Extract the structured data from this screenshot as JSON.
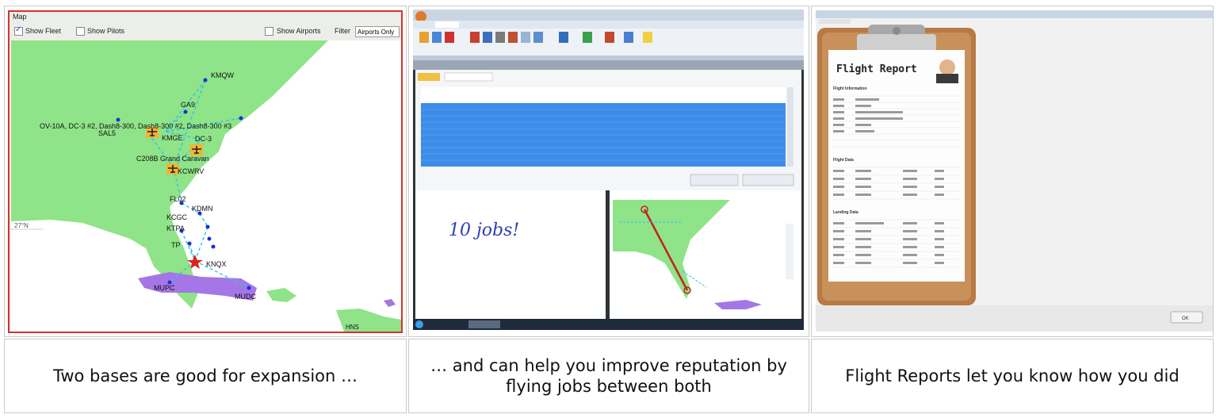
{
  "panel1": {
    "window_title": "Map",
    "show_fleet": "Show Fleet",
    "show_pilots": "Show Pilots",
    "show_airports": "Show Airports",
    "filter_label": "Filter",
    "filter_value": "Airports Only",
    "map_labels": {
      "kmqw": "KMQW",
      "ga9": "GA9",
      "fleet": "OV-10A, DC-3 #2, Dash8-300, Dash8-300 #2, Dash8-300 #3",
      "sal5": "SAL5",
      "kmge": "KMGE",
      "dc3": "DC-3",
      "c208b": "C208B Grand Caravan",
      "kcwrv": "KCWRV",
      "fl02": "FL02",
      "kdmn": "KDMN",
      "kcgc": "KCGC",
      "ktpa": "KTPA",
      "tp": "TP",
      "knqx": "KNQX",
      "mupc": "MUPC",
      "mudc": "MUDC",
      "lat": "27°N",
      "hns": "HNS"
    }
  },
  "panel2": {
    "handwriting": "10 jobs!"
  },
  "panel3": {
    "title": "Flight Report",
    "sections": [
      "Flight Information",
      "Flight Data",
      "Landing Data"
    ],
    "ok": "OK"
  },
  "captions": [
    "Two bases are good for expansion …",
    "… and can help you improve reputation by flying jobs between both",
    "Flight Reports let you know how you did"
  ],
  "colors": {
    "land": "#8fe388",
    "land2": "#a576e6",
    "sea": "#ffffff",
    "route": "#2fc4e8",
    "frame": "#d9302d",
    "highlight": "#3c8dea"
  }
}
